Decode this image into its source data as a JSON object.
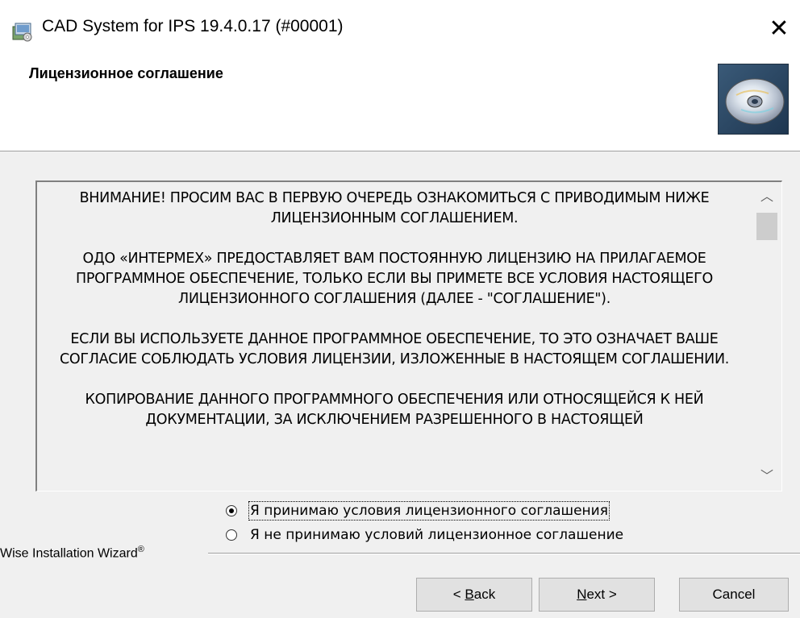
{
  "window": {
    "title": "CAD System for IPS 19.4.0.17 (#00001)",
    "close_glyph": "✕"
  },
  "header": {
    "title": "Лицензионное соглашение"
  },
  "license": {
    "paragraphs": [
      "ВНИМАНИЕ! ПРОСИМ ВАС В ПЕРВУЮ ОЧЕРЕДЬ ОЗНАКОМИТЬСЯ С ПРИВОДИМЫМ НИЖЕ ЛИЦЕНЗИОННЫМ СОГЛАШЕНИЕМ.",
      "ОДО «ИНТЕРМЕХ» ПРЕДОСТАВЛЯЕТ ВАМ ПОСТОЯННУЮ ЛИЦЕНЗИЮ НА ПРИЛАГАЕМОЕ ПРОГРАММНОЕ ОБЕСПЕЧЕНИЕ, ТОЛЬКО ЕСЛИ ВЫ ПРИМЕТЕ ВСЕ УСЛОВИЯ НАСТОЯЩЕГО ЛИЦЕНЗИОННОГО СОГЛАШЕНИЯ (ДАЛЕЕ - \"СОГЛАШЕНИЕ\").",
      "ЕСЛИ ВЫ ИСПОЛЬЗУЕТЕ ДАННОЕ ПРОГРАММНОЕ ОБЕСПЕЧЕНИЕ, ТО ЭТО ОЗНАЧАЕТ ВАШЕ СОГЛАСИЕ СОБЛЮДАТЬ УСЛОВИЯ ЛИЦЕНЗИИ, ИЗЛОЖЕННЫЕ В НАСТОЯЩЕМ СОГЛАШЕНИИ.",
      "КОПИРОВАНИЕ ДАННОГО ПРОГРАММНОГО ОБЕСПЕЧЕНИЯ ИЛИ ОТНОСЯЩЕЙСЯ К НЕЙ ДОКУМЕНТАЦИИ, ЗА ИСКЛЮЧЕНИЕМ РАЗРЕШЕННОГО В НАСТОЯЩЕЙ"
    ],
    "scroll_up_glyph": "︿",
    "scroll_down_glyph": "﹀"
  },
  "options": {
    "accept_label": "Я принимаю условия лицензионного соглашения",
    "decline_label": "Я не принимаю условий лицензионное соглашение",
    "selected": "accept"
  },
  "branding": {
    "text": "Wise Installation Wizard",
    "mark": "®"
  },
  "buttons": {
    "back_prefix": "< ",
    "back_key": "B",
    "back_rest": "ack",
    "next_key": "N",
    "next_rest": "ext >",
    "cancel": "Cancel"
  },
  "icons": {
    "app": "installer-app-icon",
    "header": "cd-disc-icon"
  }
}
